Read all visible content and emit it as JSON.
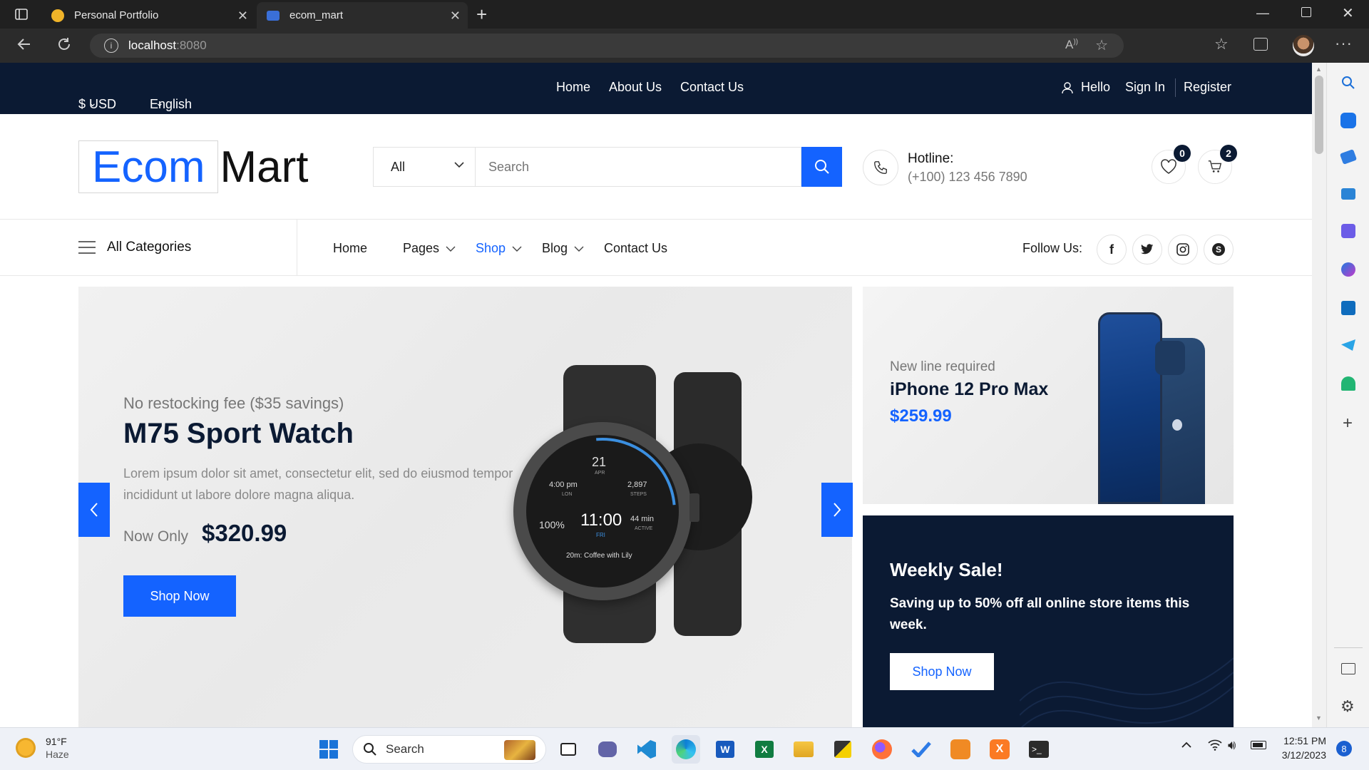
{
  "browser": {
    "tabs": [
      {
        "title": "Personal Portfolio",
        "active": false
      },
      {
        "title": "ecom_mart",
        "active": true
      }
    ],
    "url_host": "localhost",
    "url_port": ":8080",
    "avatar_initials": ""
  },
  "topbar": {
    "currency": "$ USD",
    "language": "English",
    "nav": [
      "Home",
      "About Us",
      "Contact Us"
    ],
    "hello": "Hello",
    "sign_in": "Sign In",
    "register": "Register"
  },
  "header": {
    "logo_left": "Ecom",
    "logo_right": "Mart",
    "search_category": "All",
    "search_placeholder": "Search",
    "hotline_label": "Hotline:",
    "hotline_number": "(+100) 123 456 7890",
    "wishlist_count": "0",
    "cart_count": "2"
  },
  "nav": {
    "all_categories": "All Categories",
    "items": [
      {
        "label": "Home",
        "dropdown": false,
        "active": false
      },
      {
        "label": "Pages",
        "dropdown": true,
        "active": false
      },
      {
        "label": "Shop",
        "dropdown": true,
        "active": true
      },
      {
        "label": "Blog",
        "dropdown": true,
        "active": false
      },
      {
        "label": "Contact Us",
        "dropdown": false,
        "active": false
      }
    ],
    "follow_label": "Follow Us:",
    "social_icons": [
      "facebook-icon",
      "twitter-icon",
      "instagram-icon",
      "skype-icon"
    ]
  },
  "hero": {
    "kicker": "No restocking fee ($35 savings)",
    "title": "M75 Sport Watch",
    "desc_line1": "Lorem ipsum dolor sit amet, consectetur elit, sed do eiusmod tempor",
    "desc_line2": "incididunt ut labore dolore magna aliqua.",
    "now_only": "Now Only",
    "price": "$320.99",
    "cta": "Shop Now",
    "watch": {
      "day": "21",
      "month": "APR",
      "time_left": "4:00 pm",
      "city": "LON",
      "steps": "2,897",
      "steps_label": "STEPS",
      "battery": "100%",
      "clock": "11:00",
      "weekday": "FRI",
      "active_min": "44 min",
      "active_label": "ACTIVE",
      "event": "20m: Coffee with Lily"
    }
  },
  "promo_phone": {
    "kicker": "New line required",
    "title": "iPhone 12 Pro Max",
    "price": "$259.99"
  },
  "promo_sale": {
    "title": "Weekly Sale!",
    "desc_line1": "Saving up to 50% off all online store items this",
    "desc_line2": "week.",
    "cta": "Shop Now"
  },
  "taskbar": {
    "weather_temp": "91°F",
    "weather_desc": "Haze",
    "search_label": "Search",
    "time": "12:51 PM",
    "date": "3/12/2023",
    "notification_count": "8"
  },
  "colors": {
    "brand_blue": "#1463ff",
    "dark_navy": "#0b1a33"
  }
}
